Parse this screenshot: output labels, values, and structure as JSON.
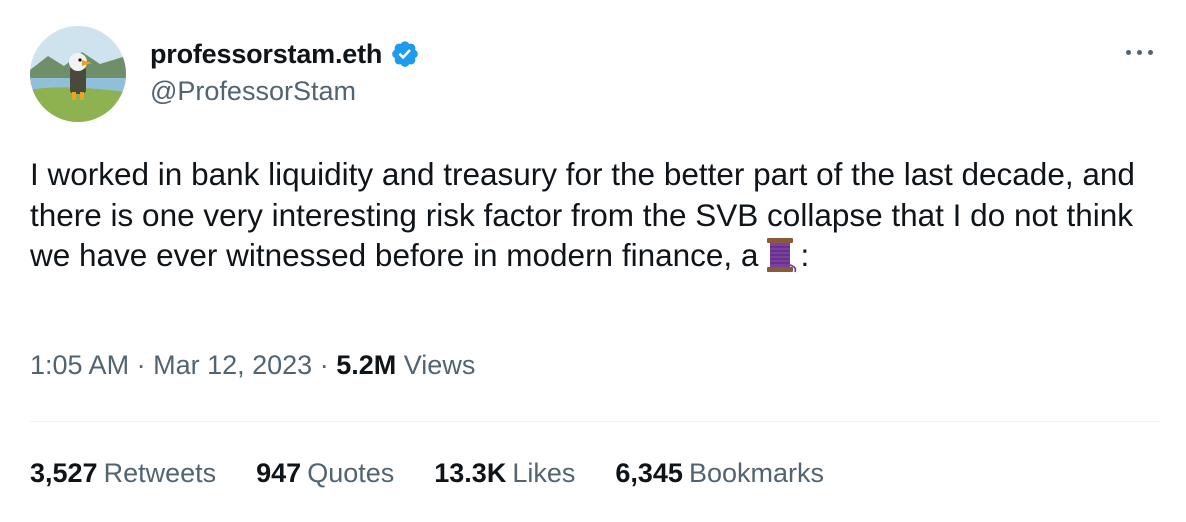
{
  "author": {
    "display_name": "professorstam.eth",
    "handle": "@ProfessorStam",
    "verified": true,
    "verified_color": "#1d9bf0"
  },
  "menu_icon": "more-horizontal-icon",
  "tweet": {
    "text_before_emoji": "I worked in bank liquidity and treasury for the better part of the last decade, and there is one very interesting risk factor from the SVB collapse that I do not think we have ever witnessed before in modern finance, a",
    "emoji": "thread-spool-emoji",
    "text_after_emoji": ":"
  },
  "meta": {
    "time": "1:05 AM",
    "separator": "·",
    "date": "Mar 12, 2023",
    "views_count": "5.2M",
    "views_label": "Views"
  },
  "stats": [
    {
      "count": "3,527",
      "label": "Retweets"
    },
    {
      "count": "947",
      "label": "Quotes"
    },
    {
      "count": "13.3K",
      "label": "Likes"
    },
    {
      "count": "6,345",
      "label": "Bookmarks"
    }
  ],
  "colors": {
    "text_primary": "#0f1419",
    "text_secondary": "#536471",
    "divider": "#eff3f4",
    "thread_emoji": "#7b3fa0"
  }
}
